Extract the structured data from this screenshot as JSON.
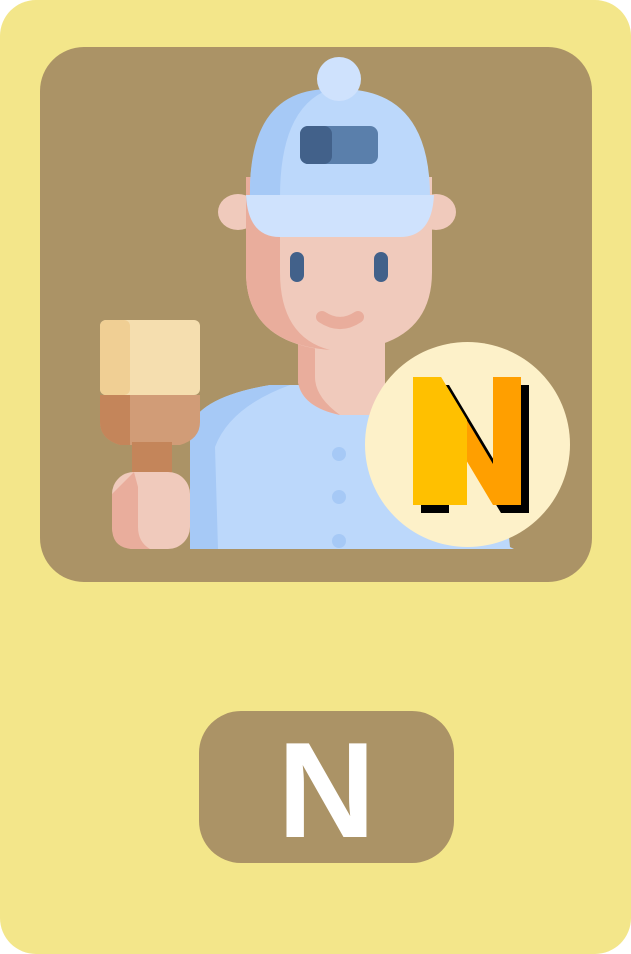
{
  "card": {
    "background_color": "#f3e68a",
    "frame_color": "#ab9366",
    "illustration_icon": "painter-with-brush-icon",
    "badge": {
      "letter": "N",
      "circle_color": "#fdf1c9",
      "letter_color_light": "#ffc000",
      "letter_color_dark": "#ff9f00",
      "shadow_color": "#000000"
    },
    "label": {
      "text": "N",
      "text_color": "#ffffff"
    }
  }
}
